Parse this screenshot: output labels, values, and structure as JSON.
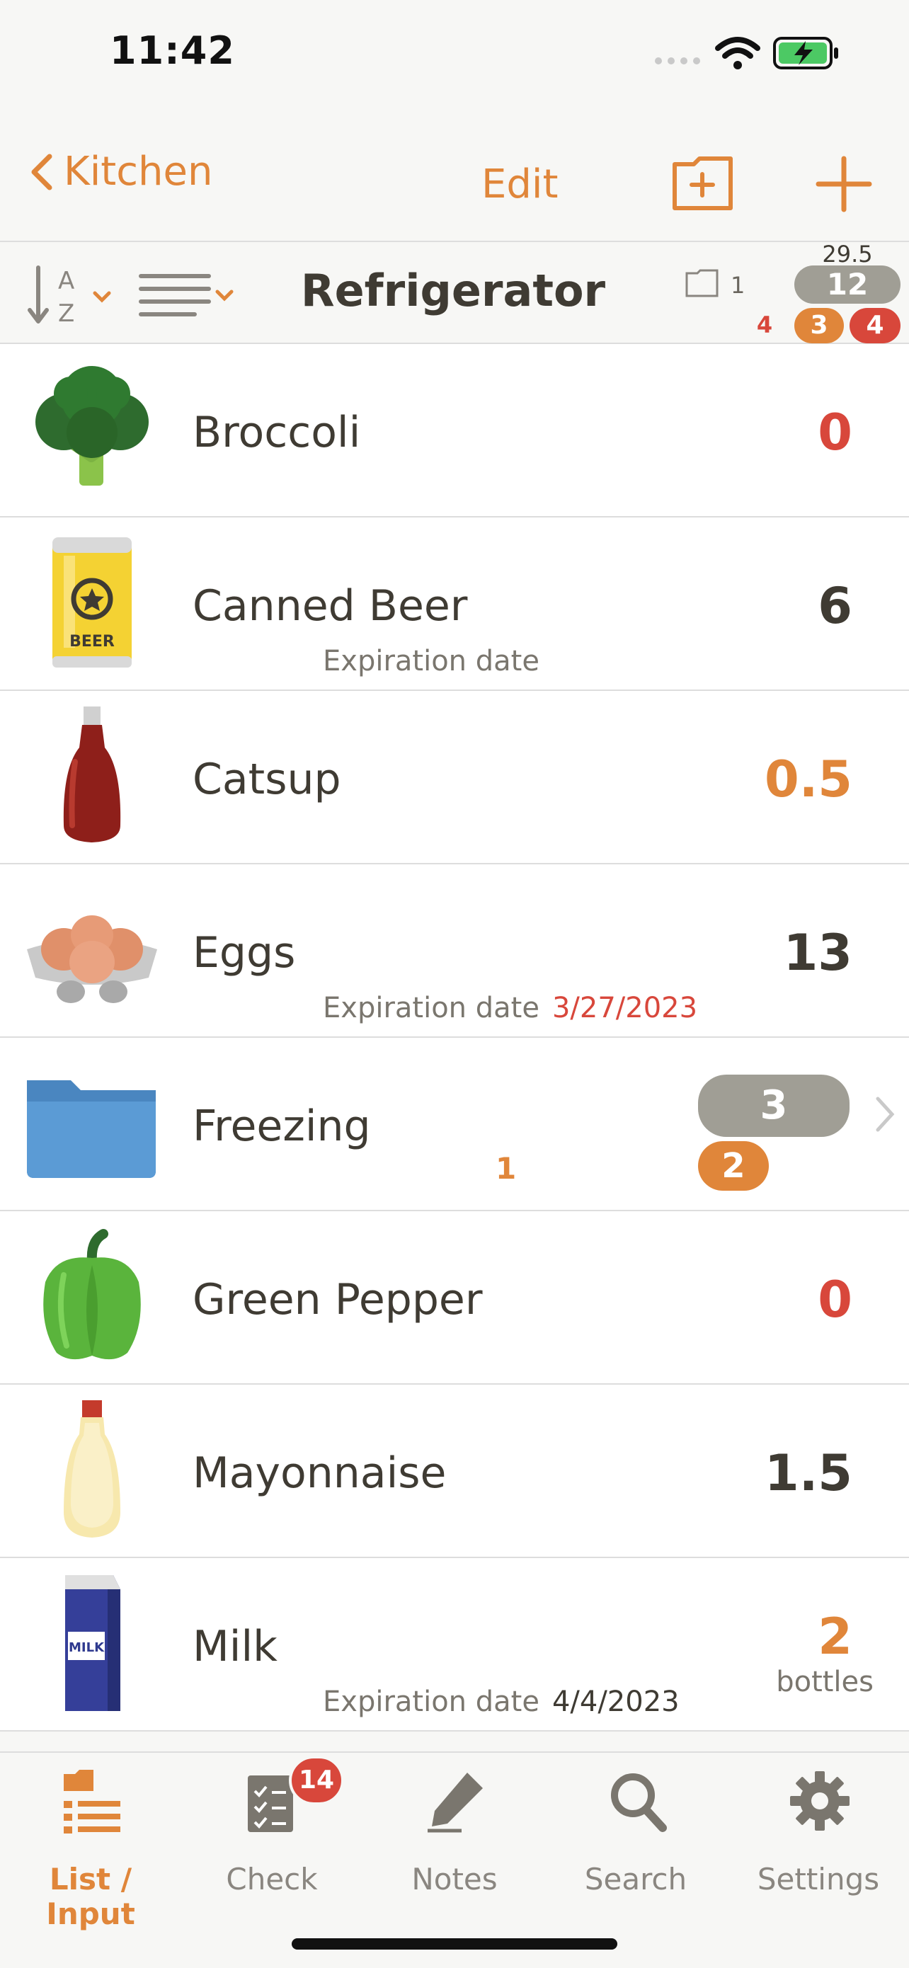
{
  "status_bar": {
    "time": "11:42"
  },
  "nav": {
    "back_label": "Kitchen",
    "edit_label": "Edit"
  },
  "toolbar": {
    "title": "Refrigerator",
    "folder_count": "1",
    "total_value": "29.5",
    "total_count": "12",
    "left_red_count": "4",
    "orange_badge": "3",
    "red_badge": "4"
  },
  "items": [
    {
      "name": "Broccoli",
      "qty": "0",
      "qty_color": "#d8473b",
      "icon": "broccoli-icon"
    },
    {
      "name": "Canned Beer",
      "qty": "6",
      "qty_color": "#3f3b33",
      "icon": "beer-can-icon",
      "exp_label": "Expiration date",
      "exp_date": "",
      "can_text": "BEER"
    },
    {
      "name": "Catsup",
      "qty": "0.5",
      "qty_color": "#e0863a",
      "icon": "ketchup-bottle-icon"
    },
    {
      "name": "Eggs",
      "qty": "13",
      "qty_color": "#3f3b33",
      "icon": "eggs-icon",
      "exp_label": "Expiration date",
      "exp_date": "3/27/2023",
      "exp_color": "#d8473b"
    },
    {
      "name": "Freezing",
      "icon": "folder-icon",
      "folder_count": "1",
      "gray_badge": "3",
      "orange_badge": "2"
    },
    {
      "name": "Green Pepper",
      "qty": "0",
      "qty_color": "#d8473b",
      "icon": "green-pepper-icon"
    },
    {
      "name": "Mayonnaise",
      "qty": "1.5",
      "qty_color": "#3f3b33",
      "icon": "mayonnaise-bottle-icon"
    },
    {
      "name": "Milk",
      "qty": "2",
      "qty_color": "#e0863a",
      "unit": "bottles",
      "icon": "milk-carton-icon",
      "exp_label": "Expiration date",
      "exp_date": "4/4/2023",
      "exp_color": "#3f3b33",
      "carton_text": "MILK"
    }
  ],
  "tabs": [
    {
      "label": "List / Input",
      "icon": "list-folder-icon",
      "active": true
    },
    {
      "label": "Check",
      "icon": "checklist-icon",
      "badge": "14"
    },
    {
      "label": "Notes",
      "icon": "pencil-icon"
    },
    {
      "label": "Search",
      "icon": "search-icon"
    },
    {
      "label": "Settings",
      "icon": "gear-icon"
    }
  ],
  "colors": {
    "accent": "#e0863a",
    "alert": "#d8473b",
    "gray_badge": "#a09e95"
  }
}
